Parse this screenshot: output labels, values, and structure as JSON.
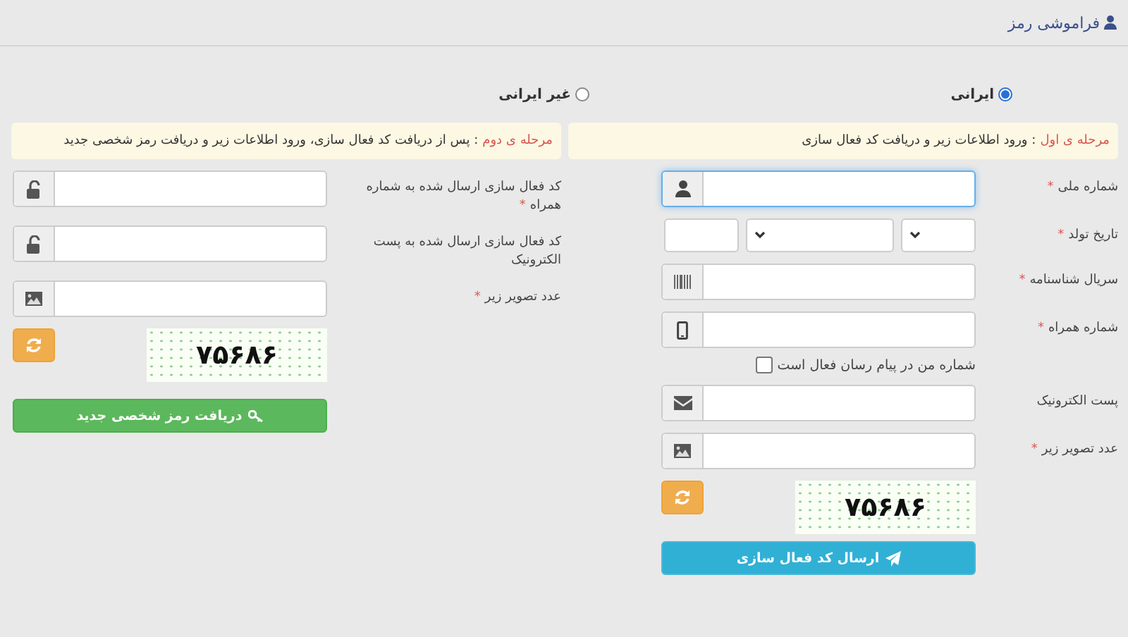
{
  "header": {
    "title": "فراموشی رمز"
  },
  "nationality": [
    {
      "label": "ایرانی",
      "selected": true
    },
    {
      "label": "غیر ایرانی",
      "selected": false
    }
  ],
  "steps": [
    {
      "step": "مرحله ی اول",
      "note": ": ورود اطلاعات زیر و دریافت کد فعال سازی",
      "fields": [
        {
          "kind": "input",
          "label": "شماره ملی",
          "required_mark": "*",
          "focused": true
        },
        {
          "kind": "date",
          "label": "تاریخ تولد",
          "required_mark": "*"
        },
        {
          "kind": "input",
          "label": "سریال شناسنامه",
          "required_mark": "*",
          "focused": false
        },
        {
          "kind": "input",
          "label": "شماره همراه",
          "required_mark": "*",
          "focused": false
        },
        {
          "kind": "checkbox",
          "label": "شماره من در پیام رسان فعال است",
          "checked": false
        },
        {
          "kind": "input",
          "label": "پست الکترونیک",
          "focused": false
        },
        {
          "kind": "input",
          "label": "عدد تصویر زیر",
          "required_mark": "*",
          "focused": false
        },
        {
          "kind": "captcha",
          "code": "۷۵۶۸۶"
        }
      ],
      "button": {
        "kind": "send",
        "label": "ارسال کد فعال سازی"
      }
    },
    {
      "step": "مرحله ی دوم",
      "note": ": پس از دریافت کد فعال سازی، ورود اطلاعات زیر و دریافت رمز شخصی جدید",
      "fields": [
        {
          "kind": "input",
          "label": "کد فعال سازی ارسال شده به شماره همراه",
          "required_mark": "*",
          "focused": false
        },
        {
          "kind": "input",
          "label": "کد فعال سازی ارسال شده به پست الکترونیک",
          "focused": false
        },
        {
          "kind": "input",
          "label": "عدد تصویر زیر",
          "required_mark": "*",
          "focused": false
        },
        {
          "kind": "captcha",
          "code": "۷۵۶۸۶"
        }
      ],
      "button": {
        "kind": "key",
        "label": "دریافت رمز شخصی جدید"
      }
    }
  ]
}
